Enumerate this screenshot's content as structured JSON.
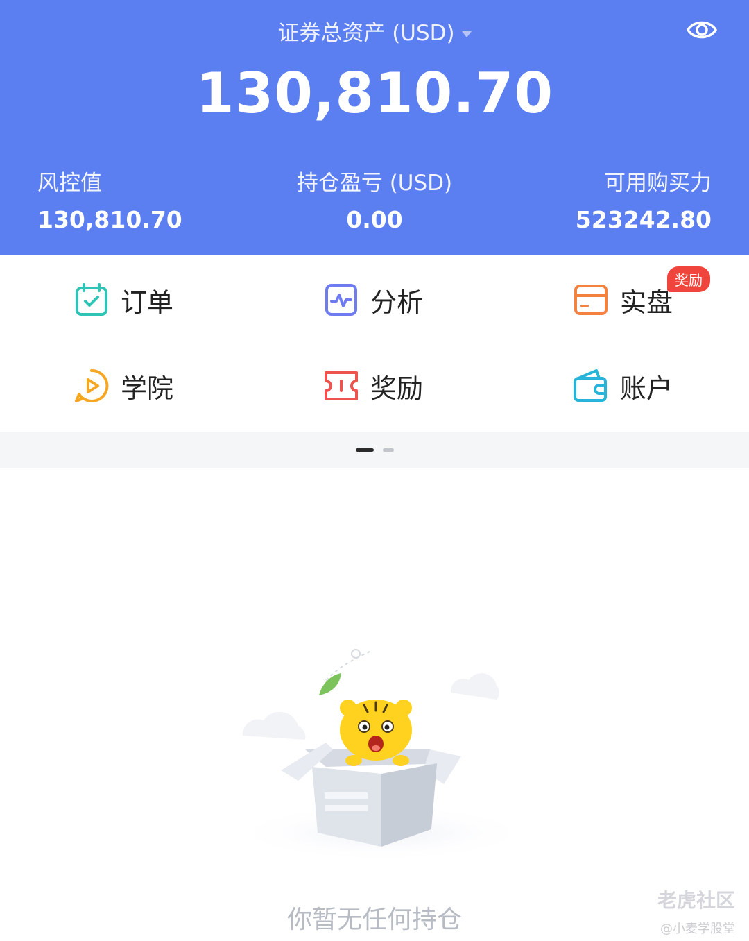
{
  "header": {
    "account_title": "证券总资产 (USD)",
    "total_assets": "130,810.70",
    "stats": [
      {
        "label": "风控值",
        "value": "130,810.70"
      },
      {
        "label": "持仓盈亏 (USD)",
        "value": "0.00"
      },
      {
        "label": "可用购买力",
        "value": "523242.80"
      }
    ],
    "eye_icon": "eye-icon"
  },
  "grid": {
    "items": [
      {
        "label": "订单",
        "icon": "calendar-check-icon",
        "color": "#2ec4b6"
      },
      {
        "label": "分析",
        "icon": "pulse-chart-icon",
        "color": "#6f7bf0"
      },
      {
        "label": "实盘",
        "icon": "card-icon",
        "color": "#f5813f"
      },
      {
        "label": "学院",
        "icon": "play-circle-icon",
        "color": "#f5a623"
      },
      {
        "label": "奖励",
        "icon": "ticket-icon",
        "color": "#ef5350"
      },
      {
        "label": "账户",
        "icon": "wallet-icon",
        "color": "#26b5d9"
      }
    ],
    "badge": "奖励"
  },
  "pager": {
    "pages": 2,
    "active": 1
  },
  "empty_state": {
    "text": "你暂无任何持仓"
  },
  "watermark": {
    "main": "老虎社区",
    "sub": "@小麦学股堂"
  },
  "colors": {
    "header_bg": "#5b7ef0",
    "badge_bg": "#f0453d"
  }
}
